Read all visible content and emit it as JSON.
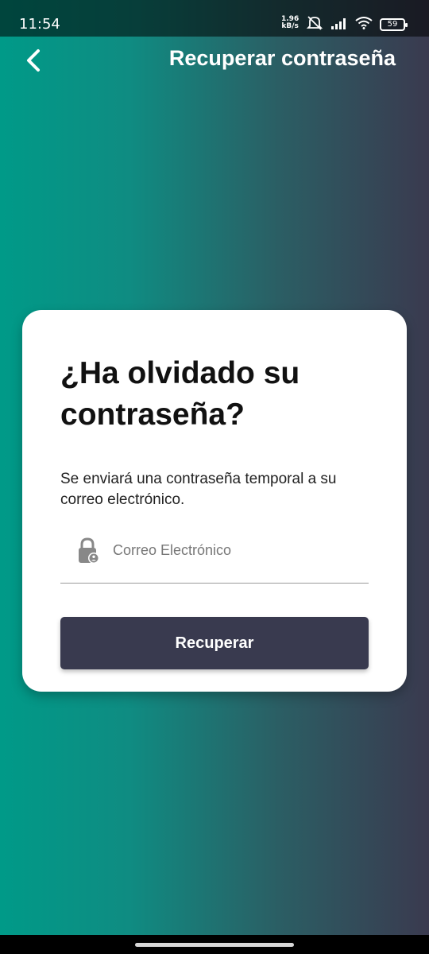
{
  "status_bar": {
    "time": "11:54",
    "net_speed_value": "1.96",
    "net_speed_unit": "kB/s",
    "battery": "59",
    "icons": [
      "mute-icon",
      "signal-icon",
      "wifi-icon",
      "battery-icon"
    ]
  },
  "app_bar": {
    "back_icon": "chevron-left-icon",
    "title": "Recuperar contraseña"
  },
  "card": {
    "heading": "¿Ha olvidado su contraseña?",
    "description": "Se enviará una contraseña temporal a su correo electrónico.",
    "email_field": {
      "icon": "lock-person-icon",
      "placeholder": "Correo Electrónico",
      "value": ""
    },
    "submit_label": "Recuperar"
  },
  "colors": {
    "gradient_start": "#009a88",
    "gradient_end": "#3a3a4f",
    "button_bg": "#393a4f",
    "card_bg": "#ffffff"
  }
}
